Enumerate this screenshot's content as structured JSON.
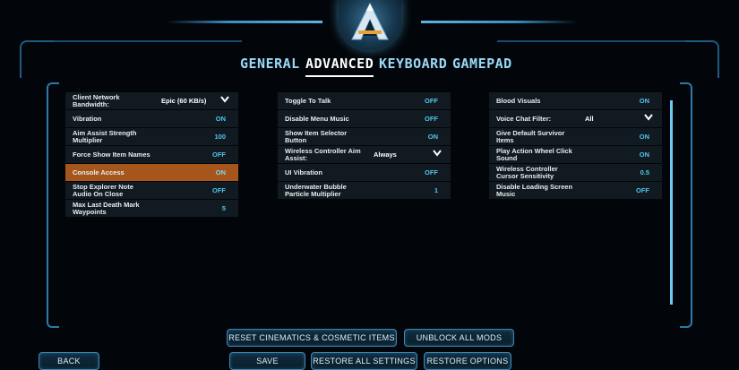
{
  "tabs": [
    "GENERAL",
    "ADVANCED",
    "KEYBOARD",
    "GAMEPAD"
  ],
  "active_tab": "ADVANCED",
  "colors": {
    "accent": "#52c6ef",
    "highlight": "#a7561b",
    "frame": "#2a7bab"
  },
  "column1": [
    {
      "label": "Client Network Bandwidth:",
      "dropdown": "Epic (60 KB/s)"
    },
    {
      "label": "Vibration",
      "value": "ON"
    },
    {
      "label": "Aim Assist Strength Multiplier",
      "value": "100"
    },
    {
      "label": "Force Show Item Names",
      "value": "OFF"
    },
    {
      "label": "Console Access",
      "value": "ON",
      "highlighted": true
    },
    {
      "label": "Stop Explorer Note Audio On Close",
      "value": "OFF"
    },
    {
      "label": "Max Last Death Mark Waypoints",
      "value": "5"
    }
  ],
  "column2": [
    {
      "label": "Toggle To Talk",
      "value": "OFF"
    },
    {
      "label": "Disable Menu Music",
      "value": "OFF"
    },
    {
      "label": "Show Item Selector Button",
      "value": "ON"
    },
    {
      "label": "Wireless Controller Aim Assist:",
      "dropdown": "Always"
    },
    {
      "label": "UI Vibration",
      "value": "OFF"
    },
    {
      "label": "Underwater Bubble Particle Multiplier",
      "value": "1"
    }
  ],
  "column3": [
    {
      "label": "Blood Visuals",
      "value": "ON"
    },
    {
      "label": "Voice Chat Filter:",
      "dropdown": "All"
    },
    {
      "label": "Give Default Survivor Items",
      "value": "ON"
    },
    {
      "label": "Play Action Wheel Click Sound",
      "value": "ON"
    },
    {
      "label": "Wireless Controller Cursor Sensitivity",
      "value": "0.5"
    },
    {
      "label": "Disable Loading Screen Music",
      "value": "OFF"
    }
  ],
  "buttons": {
    "reset": "RESET CINEMATICS & COSMETIC ITEMS",
    "unblock": "UNBLOCK ALL MODS",
    "back": "BACK",
    "save": "SAVE",
    "restore_all": "RESTORE ALL SETTINGS",
    "restore_options": "RESTORE OPTIONS"
  }
}
